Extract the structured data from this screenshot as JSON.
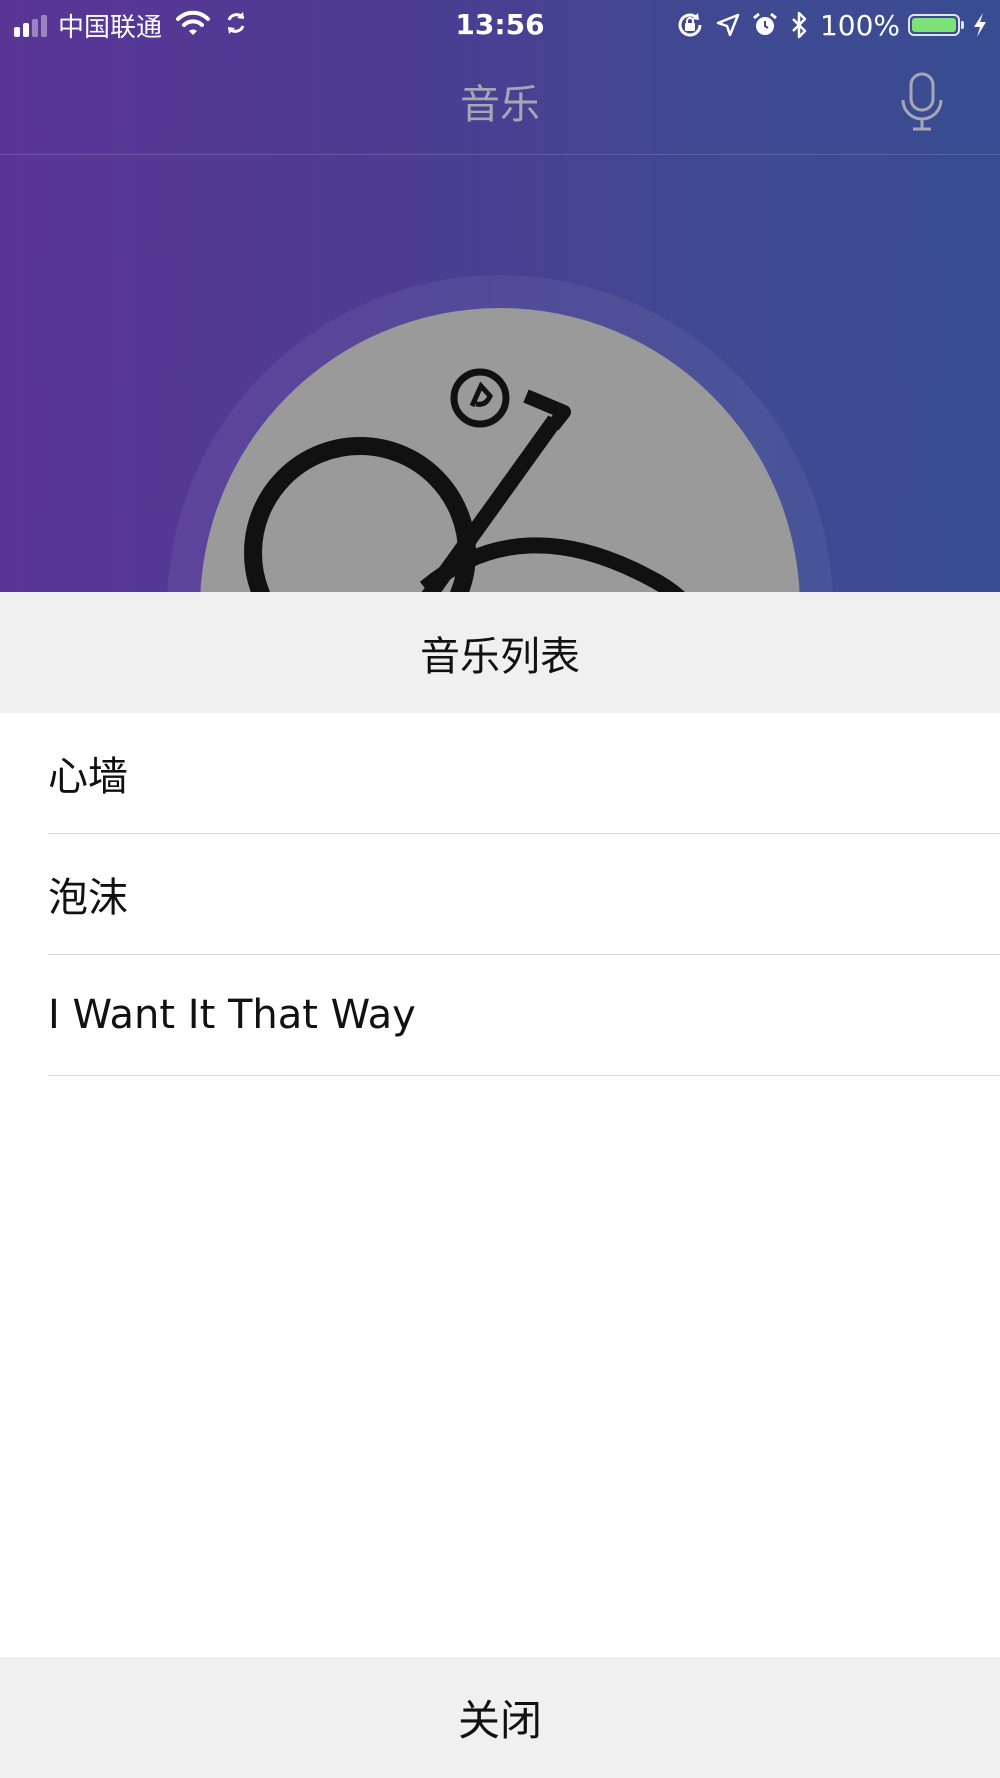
{
  "status_bar": {
    "carrier": "中国联通",
    "time": "13:56",
    "battery_percent": "100%",
    "signal_bars_filled": 2,
    "signal_bars_total": 4,
    "icons": [
      "signal-icon",
      "wifi-icon",
      "sync-icon",
      "rotation-lock-icon",
      "location-icon",
      "alarm-icon",
      "bluetooth-icon",
      "battery-icon",
      "charging-icon"
    ]
  },
  "nav": {
    "title": "音乐",
    "right_icon": "microphone-icon"
  },
  "now_playing": {
    "cover_icon": "album-cover-logo"
  },
  "music_list": {
    "title": "音乐列表",
    "songs": [
      {
        "title": "心墙"
      },
      {
        "title": "泡沫"
      },
      {
        "title": "I Want It That Way"
      }
    ],
    "close_label": "关闭"
  },
  "colors": {
    "gradient_start": "#5a3596",
    "gradient_end": "#394c91",
    "nav_title": "#a7a7b4",
    "sheet_header_bg": "#f0f0f0",
    "battery_fill": "#7ee27a",
    "divider": "#d8d8d8",
    "text": "#111111"
  }
}
